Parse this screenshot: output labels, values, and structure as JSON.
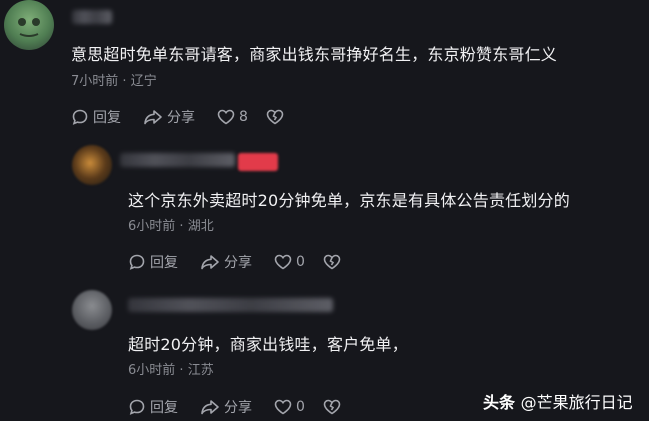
{
  "comments": [
    {
      "content": "意思超时免单东哥请客，商家出钱东哥挣好名生，东京粉赞东哥仁义",
      "time": "7小时前",
      "location": "辽宁",
      "reply_label": "回复",
      "share_label": "分享",
      "like_count": "8"
    },
    {
      "content": "这个京东外卖超时20分钟免单，京东是有具体公告责任划分的",
      "time": "6小时前",
      "location": "湖北",
      "reply_label": "回复",
      "share_label": "分享",
      "like_count": "0"
    },
    {
      "content": "超时20分钟，商家出钱哇，客户免单，",
      "time": "6小时前",
      "location": "江苏",
      "reply_label": "回复",
      "share_label": "分享",
      "like_count": "0"
    }
  ],
  "separator": "·",
  "watermark": {
    "brand": "头条",
    "handle": "@芒果旅行日记"
  },
  "colors": {
    "background": "#16171c",
    "text": "#f1f1f3",
    "meta": "#8a8c93",
    "tag": "#e23b4a"
  }
}
